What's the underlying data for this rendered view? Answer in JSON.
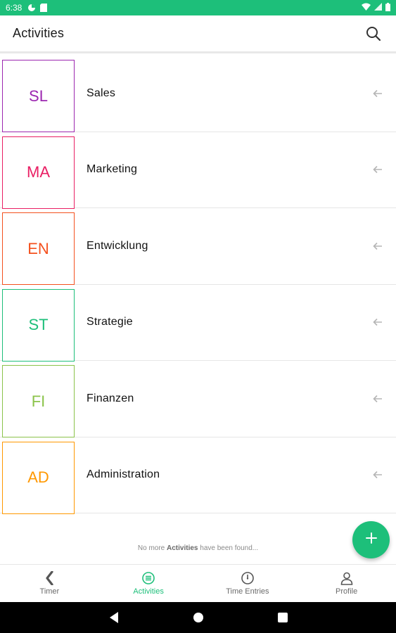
{
  "status_bar": {
    "time": "6:38"
  },
  "app_bar": {
    "title": "Activities"
  },
  "activities": [
    {
      "initials": "SL",
      "name": "Sales",
      "color": "#9c27b0"
    },
    {
      "initials": "MA",
      "name": "Marketing",
      "color": "#e91e63"
    },
    {
      "initials": "EN",
      "name": "Entwicklung",
      "color": "#f4511e"
    },
    {
      "initials": "ST",
      "name": "Strategie",
      "color": "#1dbf7a"
    },
    {
      "initials": "FI",
      "name": "Finanzen",
      "color": "#8bc34a"
    },
    {
      "initials": "AD",
      "name": "Administration",
      "color": "#ff9800"
    }
  ],
  "footer": {
    "prefix": "No more ",
    "bold": "Activities",
    "suffix": " have been found..."
  },
  "bottom_nav": [
    {
      "label": "Timer",
      "icon": "timer-icon"
    },
    {
      "label": "Activities",
      "icon": "list-icon",
      "active": true
    },
    {
      "label": "Time Entries",
      "icon": "clock-icon"
    },
    {
      "label": "Profile",
      "icon": "person-icon"
    }
  ],
  "colors": {
    "accent": "#1dbf7a"
  }
}
